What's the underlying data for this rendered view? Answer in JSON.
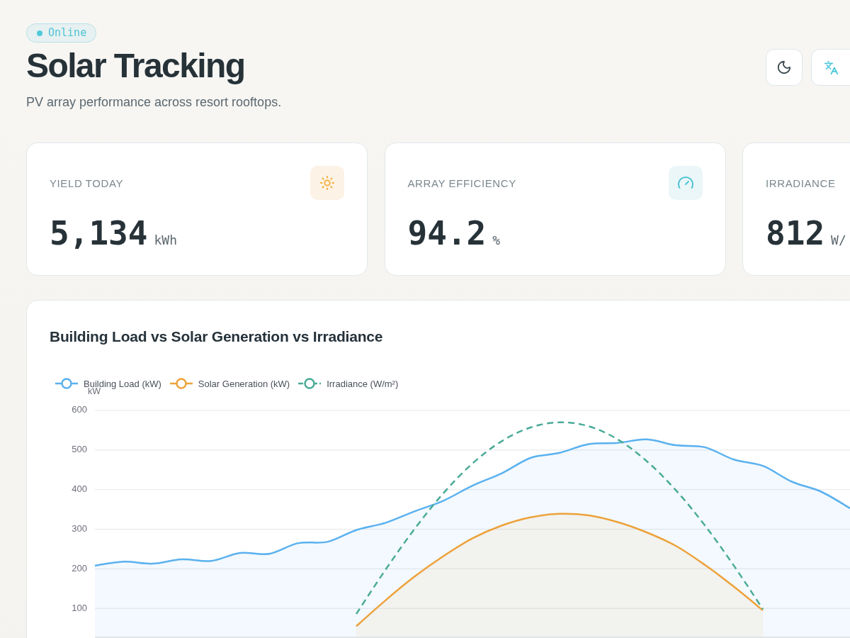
{
  "status_badge": {
    "label": "Online"
  },
  "header": {
    "title": "Solar Tracking",
    "subtitle": "PV array performance across resort rooftops."
  },
  "actions": [
    {
      "kind": "theme"
    },
    {
      "kind": "language"
    }
  ],
  "metrics": [
    {
      "label": "YIELD TODAY",
      "value": "5,134",
      "unit": "kWh",
      "kind": "yield"
    },
    {
      "label": "ARRAY EFFICIENCY",
      "value": "94.2",
      "unit": "%",
      "kind": "efficiency"
    },
    {
      "label": "IRRADIANCE",
      "value": "812",
      "unit": "W/",
      "kind": "irradiance"
    }
  ],
  "chart": {
    "title": "Building Load vs Solar Generation vs Irradiance",
    "chart_data": {
      "type": "area",
      "ylabel": "kW",
      "ylim": [
        27,
        600
      ],
      "yticks": [
        100,
        200,
        300,
        400,
        500,
        600
      ],
      "grid": true,
      "series": [
        {
          "name": "Building Load (kW)",
          "color": "#5ab1ef",
          "values": [
            208,
            218,
            213,
            224,
            220,
            240,
            238,
            265,
            268,
            298,
            316,
            345,
            372,
            410,
            441,
            480,
            493,
            515,
            518,
            527,
            512,
            507,
            476,
            460,
            420,
            395,
            353
          ]
        },
        {
          "name": "Solar Generation (kW)",
          "color": "#eda23a",
          "values": [
            null,
            null,
            null,
            null,
            null,
            null,
            null,
            null,
            null,
            55,
            120,
            180,
            232,
            277,
            309,
            330,
            339,
            335,
            318,
            292,
            258,
            210,
            155,
            95,
            null,
            null,
            null
          ]
        },
        {
          "name": "Irradiance (W/m²)",
          "color": "#4aab98",
          "type": "line",
          "line_style": "dashed",
          "values": [
            null,
            null,
            null,
            null,
            null,
            null,
            null,
            null,
            null,
            86,
            197,
            300,
            391,
            466,
            522,
            557,
            570,
            560,
            527,
            472,
            399,
            310,
            208,
            98,
            null,
            null,
            null
          ]
        }
      ]
    }
  }
}
